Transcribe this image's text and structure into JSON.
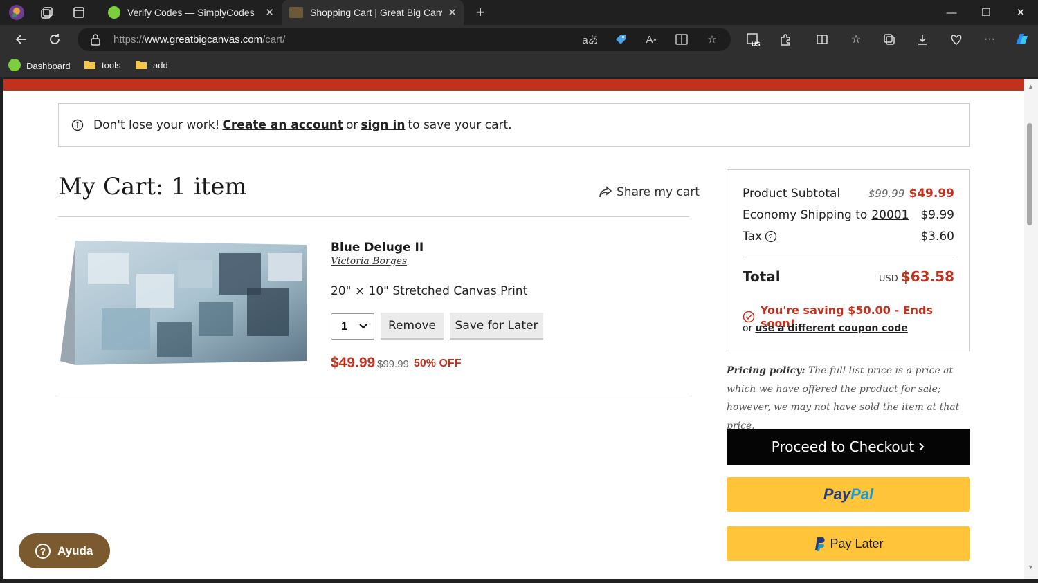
{
  "browser": {
    "tabs": [
      {
        "title": "Verify Codes — SimplyCodes",
        "close": "✕"
      },
      {
        "title": "Shopping Cart | Great Big Canvas",
        "close": "✕"
      }
    ],
    "new_tab": "+",
    "window_controls": {
      "minimize": "—",
      "restore": "❐",
      "close": "✕"
    },
    "url": {
      "scheme": "https://",
      "host": "www.greatbigcanvas.com",
      "path": "/cart/"
    },
    "bookmarks": [
      {
        "label": "Dashboard",
        "icon": "simplycodes-icon"
      },
      {
        "label": "tools",
        "icon": "folder-icon"
      },
      {
        "label": "add",
        "icon": "folder-icon"
      }
    ],
    "extension_badge": "US"
  },
  "page": {
    "notice": {
      "prefix": "Don't lose your work!",
      "create_account": "Create an account",
      "or": "or",
      "sign_in": "sign in",
      "suffix": "to save your cart."
    },
    "cart_title": "My Cart: 1 item",
    "share_label": "Share my cart",
    "item": {
      "name": "Blue Deluge II",
      "artist": "Victoria Borges",
      "size": "20\" × 10\" Stretched Canvas Print",
      "quantity": "1",
      "remove_label": "Remove",
      "save_later_label": "Save for Later",
      "price": "$49.99",
      "original_price": "$99.99",
      "discount": "50% OFF"
    },
    "summary": {
      "subtotal_label": "Product Subtotal",
      "subtotal_original": "$99.99",
      "subtotal_value": "$49.99",
      "shipping_label": "Economy Shipping to",
      "shipping_zip": "20001",
      "shipping_value": "$9.99",
      "tax_label": "Tax",
      "tax_value": "$3.60",
      "total_label": "Total",
      "total_currency": "USD",
      "total_value": "$63.58",
      "saving_text": "You're saving $50.00 - Ends soon!",
      "coupon_or": "or",
      "coupon_link": "use a different coupon code"
    },
    "pricing_policy": {
      "label": "Pricing policy:",
      "text": "The full list price is a price at which we have offered the product for sale; however, we may not have sold the item at that price."
    },
    "checkout_label": "Proceed to Checkout",
    "paypal": {
      "part1": "Pay",
      "part2": "Pal"
    },
    "paylater_label": "Pay Later",
    "help_label": "Ayuda"
  },
  "colors": {
    "accent_red": "#c0321e",
    "paypal_yellow": "#ffc439",
    "checkout_black": "#050505",
    "help_brown": "#7a5a2e"
  }
}
